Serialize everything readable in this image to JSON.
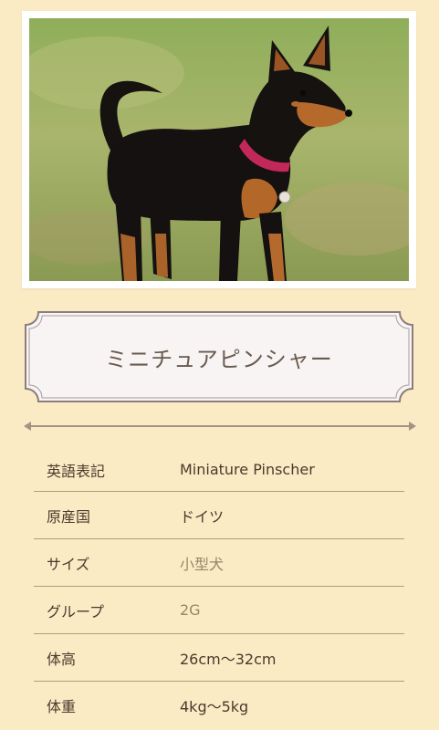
{
  "breed": {
    "name": "ミニチュアピンシャー"
  },
  "photo": {
    "icon": "dog-photo"
  },
  "info": [
    {
      "label": "英語表記",
      "value": "Miniature Pinscher"
    },
    {
      "label": "原産国",
      "value": "ドイツ"
    },
    {
      "label": "サイズ",
      "value": "小型犬"
    },
    {
      "label": "グループ",
      "value": "2G"
    },
    {
      "label": "体高",
      "value": "26cm〜32cm"
    },
    {
      "label": "体重",
      "value": "4kg〜5kg"
    }
  ],
  "colors": {
    "background": "#fbebc5",
    "row_border": "#b99a73",
    "link_text": "#9a8468"
  }
}
